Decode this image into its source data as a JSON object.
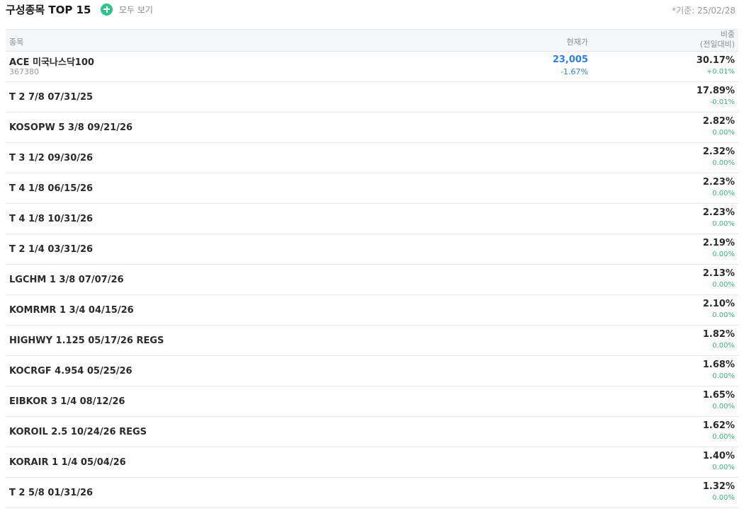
{
  "header": {
    "title": "구성종목 TOP 15",
    "view_all_label": "모두 보기",
    "base_date": "*기준: 25/02/28"
  },
  "colors": {
    "accent_green": "#2ec38b",
    "price_blue": "#2f7ee8",
    "change_green": "#3cb87a"
  },
  "table": {
    "columns": {
      "name": "종목",
      "price": "현재가",
      "weight": "비중",
      "weight_sub": "(전일대비)"
    },
    "rows": [
      {
        "name": "ACE 미국나스닥100",
        "code": "367380",
        "price": "23,005",
        "price_change": "-1.67%",
        "weight": "30.17%",
        "weight_change": "+0.01%"
      },
      {
        "name": "T 2 7/8 07/31/25",
        "weight": "17.89%",
        "weight_change": "-0.01%"
      },
      {
        "name": "KOSOPW 5 3/8 09/21/26",
        "weight": "2.82%",
        "weight_change": "0.00%"
      },
      {
        "name": "T 3 1/2 09/30/26",
        "weight": "2.32%",
        "weight_change": "0.00%"
      },
      {
        "name": "T 4 1/8 06/15/26",
        "weight": "2.23%",
        "weight_change": "0.00%"
      },
      {
        "name": "T 4 1/8 10/31/26",
        "weight": "2.23%",
        "weight_change": "0.00%"
      },
      {
        "name": "T 2 1/4 03/31/26",
        "weight": "2.19%",
        "weight_change": "0.00%"
      },
      {
        "name": "LGCHM 1 3/8 07/07/26",
        "weight": "2.13%",
        "weight_change": "0.00%"
      },
      {
        "name": "KOMRMR 1 3/4 04/15/26",
        "weight": "2.10%",
        "weight_change": "0.00%"
      },
      {
        "name": "HIGHWY 1.125 05/17/26 REGS",
        "weight": "1.82%",
        "weight_change": "0.00%"
      },
      {
        "name": "KOCRGF 4.954 05/25/26",
        "weight": "1.68%",
        "weight_change": "0.00%"
      },
      {
        "name": "EIBKOR 3 1/4 08/12/26",
        "weight": "1.65%",
        "weight_change": "0.00%"
      },
      {
        "name": "KOROIL 2.5 10/24/26 REGS",
        "weight": "1.62%",
        "weight_change": "0.00%"
      },
      {
        "name": "KORAIR 1 1/4 05/04/26",
        "weight": "1.40%",
        "weight_change": "0.00%"
      },
      {
        "name": "T 2 5/8 01/31/26",
        "weight": "1.32%",
        "weight_change": "0.00%"
      }
    ]
  }
}
